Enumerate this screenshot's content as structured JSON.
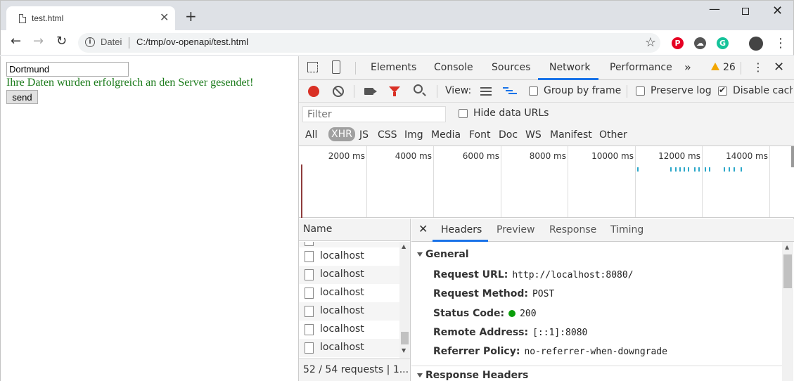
{
  "browser": {
    "tab_title": "test.html",
    "tab_close": "✕",
    "new_tab": "+",
    "url_scheme_label": "Datei",
    "url": "C:/tmp/ov-openapi/test.html"
  },
  "page": {
    "input_value": "Dortmund",
    "success_message": "Ihre Daten wurden erfolgreich an den Server gesendet!",
    "send_label": "send"
  },
  "devtools": {
    "tabs": [
      "Elements",
      "Console",
      "Sources",
      "Network",
      "Performance"
    ],
    "active_tab": "Network",
    "more_tabs": "»",
    "warning_count": "26",
    "toolbar": {
      "view_label": "View:",
      "group_by_frame": "Group by frame",
      "preserve_log": "Preserve log",
      "disable_cache": "Disable cache",
      "group_by_frame_checked": false,
      "preserve_log_checked": false,
      "disable_cache_checked": true
    },
    "filter": {
      "placeholder": "Filter",
      "hide_data_urls": "Hide data URLs"
    },
    "types": [
      "All",
      "XHR",
      "JS",
      "CSS",
      "Img",
      "Media",
      "Font",
      "Doc",
      "WS",
      "Manifest",
      "Other"
    ],
    "active_type": "XHR",
    "timeline_ticks": [
      "2000 ms",
      "4000 ms",
      "6000 ms",
      "8000 ms",
      "10000 ms",
      "12000 ms",
      "14000 ms"
    ],
    "name_header": "Name",
    "requests": [
      "localhost",
      "localhost",
      "localhost",
      "localhost",
      "localhost",
      "localhost"
    ],
    "status_text": "52 / 54 requests  |  1...",
    "detail_tabs": [
      "Headers",
      "Preview",
      "Response",
      "Timing"
    ],
    "active_detail_tab": "Headers",
    "general_title": "General",
    "general": [
      {
        "key": "Request URL:",
        "value": "http://localhost:8080/"
      },
      {
        "key": "Request Method:",
        "value": "POST"
      },
      {
        "key": "Status Code:",
        "value": "200"
      },
      {
        "key": "Remote Address:",
        "value": "[::1]:8080"
      },
      {
        "key": "Referrer Policy:",
        "value": "no-referrer-when-downgrade"
      }
    ],
    "response_headers_title": "Response Headers"
  },
  "colors": {
    "accent": "#1a73e8",
    "success_text": "#1a7a1a",
    "record_red": "#d93025",
    "status_green": "#0a9e0a"
  }
}
